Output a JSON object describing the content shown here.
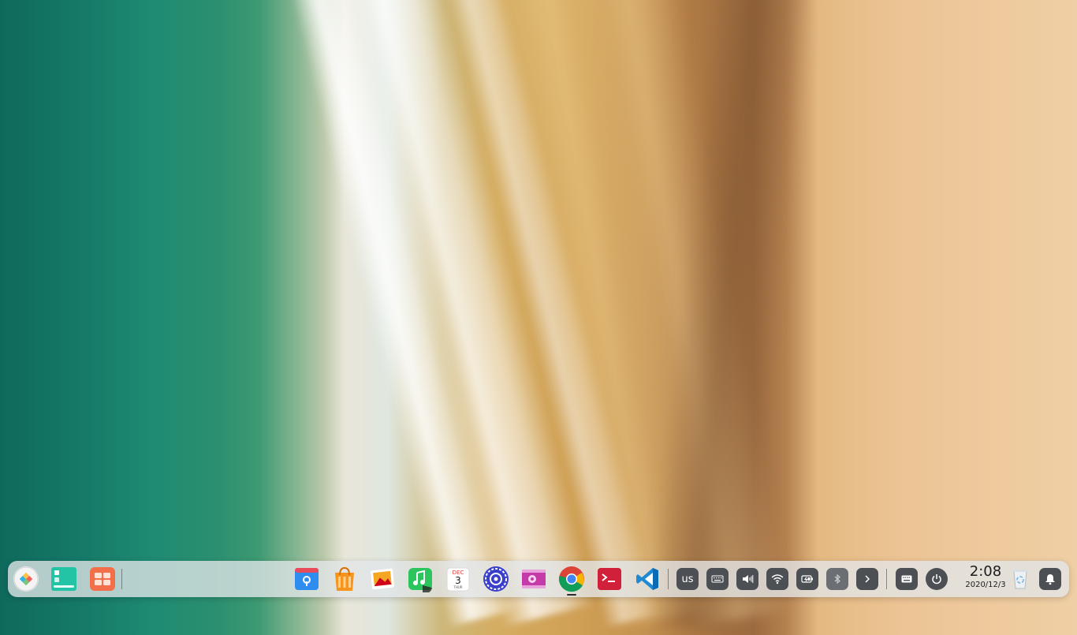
{
  "desktop": {
    "wallpaper": "beach-aerial-wallpaper"
  },
  "dock": {
    "left_apps": [
      {
        "name": "Launcher",
        "icon": "launcher-icon"
      },
      {
        "name": "Multitasking View",
        "icon": "multitasking-icon"
      },
      {
        "name": "Deepin App Store Grid",
        "icon": "app-grid-icon"
      }
    ],
    "apps": [
      {
        "name": "File Manager",
        "icon": "file-manager-icon"
      },
      {
        "name": "App Store",
        "icon": "app-store-icon"
      },
      {
        "name": "Image Viewer",
        "icon": "image-viewer-icon"
      },
      {
        "name": "Music",
        "icon": "music-icon"
      },
      {
        "name": "Calendar",
        "icon": "calendar-icon",
        "month": "DEC",
        "day": "3",
        "weekday": "THUR"
      },
      {
        "name": "Control Center",
        "icon": "control-center-icon"
      },
      {
        "name": "Movie",
        "icon": "movie-icon"
      },
      {
        "name": "Chrome",
        "icon": "chrome-icon"
      },
      {
        "name": "Terminal",
        "icon": "terminal-icon"
      },
      {
        "name": "VS Code",
        "icon": "vscode-icon"
      }
    ],
    "tray": {
      "keyboard_layout": "us",
      "items": [
        "onscreen-keyboard-icon",
        "volume-icon",
        "wifi-icon",
        "battery-icon",
        "bluetooth-icon",
        "expand-arrow-icon"
      ]
    },
    "clock": {
      "time": "2:08",
      "date": "2020/12/3"
    },
    "colors": {
      "dock_bg": "#e2e6e8",
      "tray_bg": "#4c4f53"
    }
  }
}
